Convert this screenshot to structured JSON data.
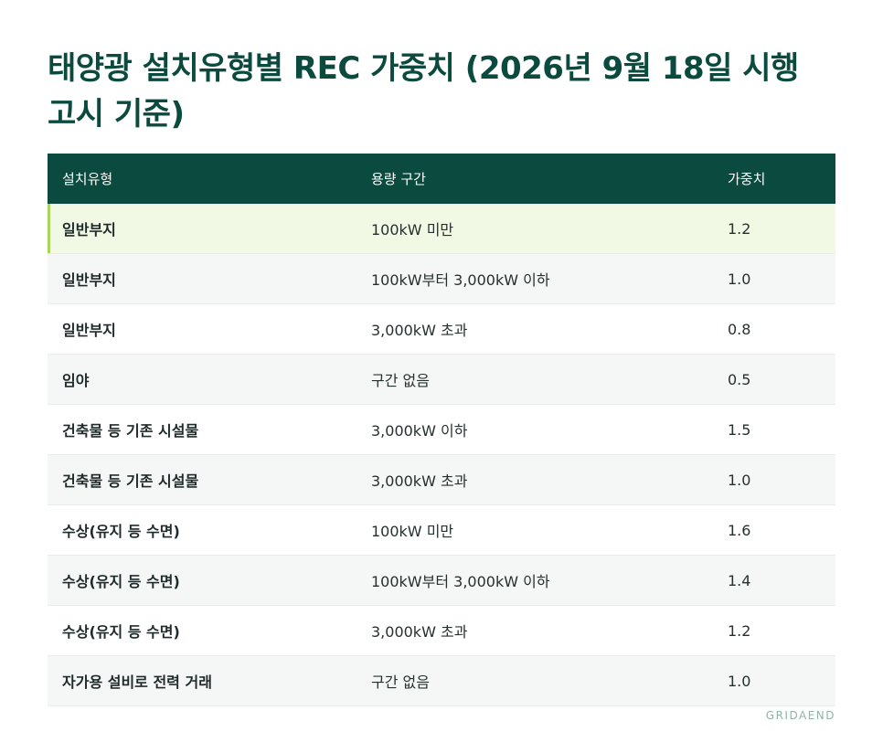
{
  "title": "태양광 설치유형별 REC 가중치 (2026년 9월 18일 시행 고시 기준)",
  "table": {
    "headers": [
      "설치유형",
      "용량 구간",
      "가중치"
    ],
    "rows": [
      {
        "type": "일반부지",
        "range": "100kW 미만",
        "weight": "1.2"
      },
      {
        "type": "일반부지",
        "range": "100kW부터 3,000kW 이하",
        "weight": "1.0"
      },
      {
        "type": "일반부지",
        "range": "3,000kW 초과",
        "weight": "0.8"
      },
      {
        "type": "임야",
        "range": "구간 없음",
        "weight": "0.5"
      },
      {
        "type": "건축물 등 기존 시설물",
        "range": "3,000kW 이하",
        "weight": "1.5"
      },
      {
        "type": "건축물 등 기존 시설물",
        "range": "3,000kW 초과",
        "weight": "1.0"
      },
      {
        "type": "수상(유지 등 수면)",
        "range": "100kW 미만",
        "weight": "1.6"
      },
      {
        "type": "수상(유지 등 수면)",
        "range": "100kW부터 3,000kW 이하",
        "weight": "1.4"
      },
      {
        "type": "수상(유지 등 수면)",
        "range": "3,000kW 초과",
        "weight": "1.2"
      },
      {
        "type": "자가용 설비로 전력 거래",
        "range": "구간 없음",
        "weight": "1.0"
      }
    ]
  },
  "brand": "GRIDAEND",
  "colors": {
    "header_bg": "#0b4a3e",
    "highlight_bg": "#f1f8e4",
    "highlight_accent": "#a7d45b"
  }
}
